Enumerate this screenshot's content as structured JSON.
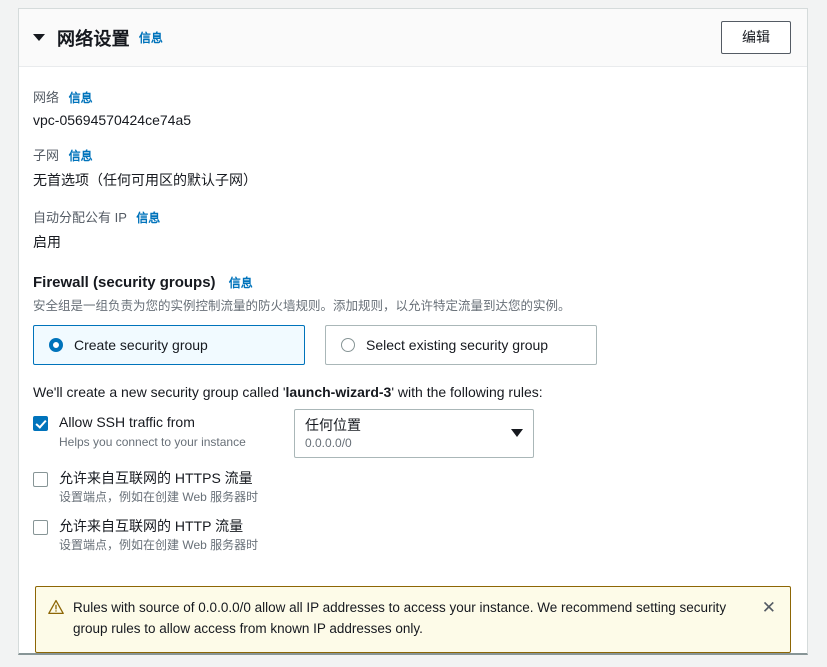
{
  "header": {
    "title": "网络设置",
    "info_label": "信息",
    "edit_label": "编辑"
  },
  "fields": {
    "network": {
      "label": "网络",
      "info_label": "信息",
      "value": "vpc-05694570424ce74a5"
    },
    "subnet": {
      "label": "子网",
      "info_label": "信息",
      "value": "无首选项（任何可用区的默认子网）"
    },
    "auto_assign_ip": {
      "label": "自动分配公有 IP",
      "info_label": "信息",
      "value": "启用"
    }
  },
  "firewall": {
    "title": "Firewall (security groups)",
    "info_label": "信息",
    "description": "安全组是一组负责为您的实例控制流量的防火墙规则。添加规则，以允许特定流量到达您的实例。",
    "options": [
      {
        "label": "Create security group",
        "selected": true
      },
      {
        "label": "Select existing security group",
        "selected": false
      }
    ],
    "note_prefix": "We'll create a new security group called '",
    "note_group_name": "launch-wizard-3",
    "note_suffix": "' with the following rules:",
    "rules": [
      {
        "label": "Allow SSH traffic from",
        "help": "Helps you connect to your instance",
        "checked": true
      },
      {
        "label": "允许来自互联网的 HTTPS 流量",
        "help": "设置端点，例如在创建 Web 服务器时",
        "checked": false
      },
      {
        "label": "允许来自互联网的 HTTP 流量",
        "help": "设置端点，例如在创建 Web 服务器时",
        "checked": false
      }
    ],
    "source_select": {
      "value": "任何位置",
      "sub_value": "0.0.0.0/0"
    }
  },
  "alert": {
    "icon": "warning-triangle-icon",
    "text": "Rules with source of 0.0.0.0/0 allow all IP addresses to access your instance. We recommend setting security group rules to allow access from known IP addresses only.",
    "close_label": "✕"
  },
  "colors": {
    "accent": "#0073bb",
    "alert_bg": "#fdfbe8",
    "alert_border": "#8d6605",
    "tile_selected_bg": "#f1faff"
  }
}
